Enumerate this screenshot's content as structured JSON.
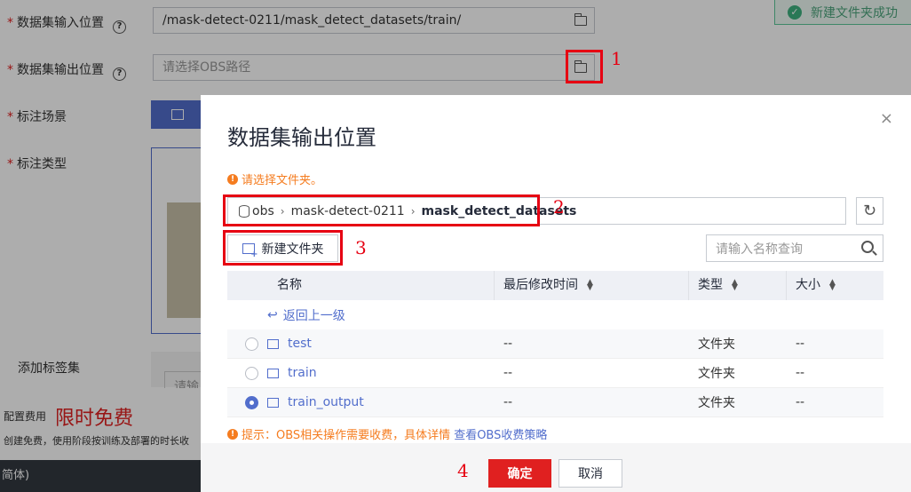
{
  "form": {
    "input_label": "数据集输入位置",
    "input_value": "/mask-detect-0211/mask_detect_datasets/train/",
    "output_label": "数据集输出位置",
    "output_placeholder": "请选择OBS路径",
    "scene_label": "标注场景",
    "type_label": "标注类型",
    "tag_label": "添加标签集",
    "tag_placeholder": "请输",
    "fee_label": "配置费用",
    "fee_value": "限时免费",
    "fee_note": "创建免费，使用阶段按训练及部署的时长收",
    "footer_text": "简体)",
    "help_glyph": "?"
  },
  "toast": {
    "text": "新建文件夹成功",
    "icon": "check-icon"
  },
  "annotations": [
    "1",
    "2",
    "3",
    "4"
  ],
  "dialog": {
    "title": "数据集输出位置",
    "close_glyph": "×",
    "warning": "请选择文件夹。",
    "path": {
      "root": "obs",
      "segments": [
        "mask-detect-0211",
        "mask_detect_datasets"
      ],
      "separator": "›"
    },
    "new_folder_label": "新建文件夹",
    "search_placeholder": "请输入名称查询",
    "columns": [
      "名称",
      "最后修改时间",
      "类型",
      "大小"
    ],
    "back_label": "返回上一级",
    "rows": [
      {
        "name": "test",
        "modified": "--",
        "type": "文件夹",
        "size": "--",
        "selected": false
      },
      {
        "name": "train",
        "modified": "--",
        "type": "文件夹",
        "size": "--",
        "selected": false
      },
      {
        "name": "train_output",
        "modified": "--",
        "type": "文件夹",
        "size": "--",
        "selected": true
      }
    ],
    "tip_text": "提示：OBS相关操作需要收费，具体详情",
    "tip_link": "查看OBS收费策略",
    "ok_label": "确定",
    "cancel_label": "取消"
  },
  "colors": {
    "accent": "#526ecc",
    "danger": "#e02020",
    "warning": "#f57c1f",
    "annotation": "#e60012"
  }
}
